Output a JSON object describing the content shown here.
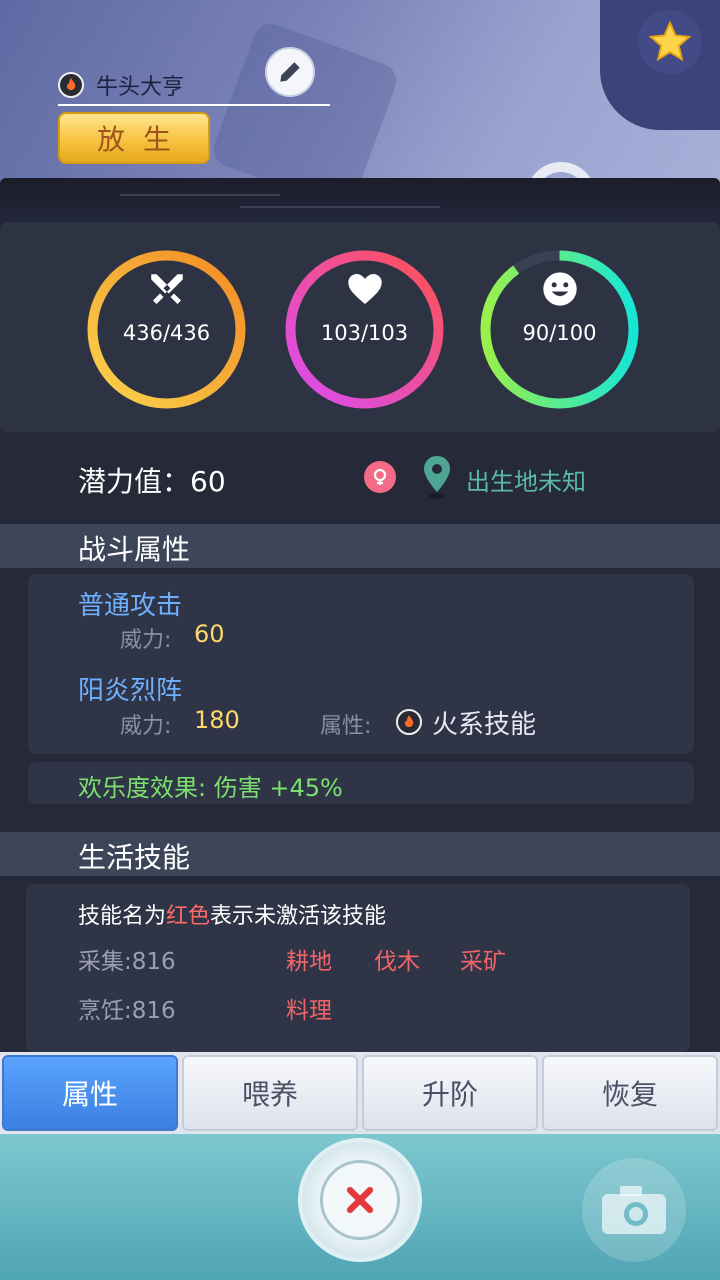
{
  "header": {
    "pet_name": "牛头大亨",
    "release_label": "放生",
    "pet_element_icon": "fire-element-icon",
    "edit_icon": "pencil-icon",
    "favorite_icon": "star-icon"
  },
  "stats": {
    "attack": {
      "text": "436/436",
      "icon": "crossed-swords-icon",
      "fraction": 1.0
    },
    "health": {
      "text": "103/103",
      "icon": "heart-icon",
      "fraction": 1.0
    },
    "happiness": {
      "text": "90/100",
      "icon": "smiley-icon",
      "fraction": 0.9
    }
  },
  "potential": {
    "text": "潜力值：60",
    "birthplace": "出生地未知",
    "gender_icon": "female-icon",
    "location_icon": "location-pin-icon"
  },
  "combat": {
    "title": "战斗属性",
    "skills": [
      {
        "name": "普通攻击",
        "power_label": "威力:",
        "power": "60"
      },
      {
        "name": "阳炎烈阵",
        "power_label": "威力:",
        "power": "180",
        "attr_label": "属性:",
        "attr": "火系技能"
      }
    ],
    "joy_effect": "欢乐度效果:  伤害 +45%"
  },
  "life": {
    "title": "生活技能",
    "note_prefix": "技能名为",
    "note_red": "红色",
    "note_suffix": "表示未激活该技能",
    "rows": [
      {
        "label": "采集:816",
        "skills": [
          "耕地",
          "伐木",
          "采矿"
        ]
      },
      {
        "label": "烹饪:816",
        "skills": [
          "料理"
        ]
      }
    ]
  },
  "tabs": [
    "属性",
    "喂养",
    "升阶",
    "恢复"
  ],
  "bottom": {
    "close_icon": "close-icon",
    "camera_icon": "camera-icon"
  },
  "colors": {
    "attack_ring": [
      "#f6c343",
      "#f59a2b"
    ],
    "health_ring": [
      "#e74cf0",
      "#ff5a5a"
    ],
    "happiness_ring": [
      "#8cf24a",
      "#1ee6d2"
    ],
    "skill_name": "#6fb0ff",
    "power_value": "#ffd86b",
    "inactive_skill": "#f0656a",
    "joy_text": "#7be06f",
    "active_tab": "#4a90f0"
  }
}
